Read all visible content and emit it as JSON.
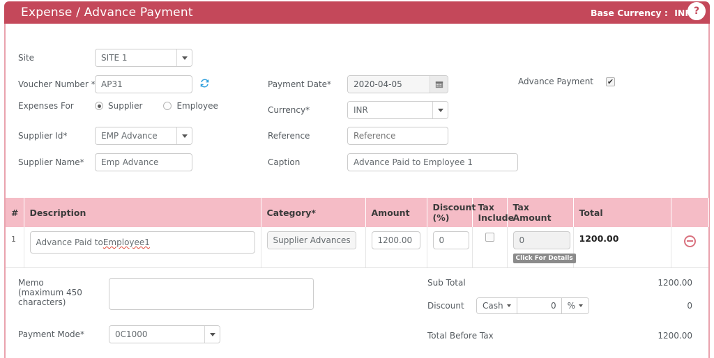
{
  "header": {
    "title": "Expense / Advance Payment",
    "base_currency_label": "Base Currency :",
    "base_currency_value": "INR",
    "help_label": "?",
    "bar_color": "#c4485a"
  },
  "form": {
    "site": {
      "label": "Site",
      "value": "SITE 1"
    },
    "voucher_number": {
      "label": "Voucher Number *",
      "value": "AP31",
      "refresh_icon": "refresh-icon"
    },
    "expenses_for": {
      "label": "Expenses For",
      "options": [
        {
          "label": "Supplier",
          "selected": true
        },
        {
          "label": "Employee",
          "selected": false
        }
      ]
    },
    "supplier_id": {
      "label": "Supplier Id*",
      "value": "EMP Advance"
    },
    "supplier_name": {
      "label": "Supplier Name*",
      "value": "Emp Advance"
    },
    "payment_date": {
      "label": "Payment Date*",
      "value": "2020-04-05",
      "icon": "calendar-icon"
    },
    "currency": {
      "label": "Currency*",
      "value": "INR"
    },
    "reference": {
      "label": "Reference",
      "value": "",
      "placeholder": "Reference"
    },
    "caption": {
      "label": "Caption",
      "value": "Advance Paid to Employee 1"
    },
    "advance_payment": {
      "label": "Advance Payment",
      "checked": true,
      "mark": "✔"
    }
  },
  "items_table": {
    "columns": [
      {
        "key": "num",
        "label": "#"
      },
      {
        "key": "description",
        "label": "Description"
      },
      {
        "key": "category",
        "label": "Category*"
      },
      {
        "key": "amount",
        "label": "Amount"
      },
      {
        "key": "discount",
        "label": "Discount (%)"
      },
      {
        "key": "tax_include",
        "label": "Tax Include"
      },
      {
        "key": "tax_amount",
        "label": "Tax Amount"
      },
      {
        "key": "total",
        "label": "Total"
      },
      {
        "key": "actions",
        "label": ""
      }
    ],
    "header_color": "#f5bcc6",
    "rows": [
      {
        "num": "1",
        "description": "Advance Paid to Employee1",
        "description_misspelled": "Employee1",
        "description_prefix": "Advance Paid to ",
        "category": "Supplier Advances",
        "amount": "1200.00",
        "discount": "0",
        "tax_include_checked": false,
        "tax_amount": "0",
        "tax_amount_tooltip": "Click For Details",
        "total": "1200.00",
        "delete_icon": "remove-circle-icon"
      }
    ]
  },
  "bottom": {
    "memo": {
      "label_line1": "Memo",
      "label_line2": "(maximum 450",
      "label_line3": "characters)",
      "value": ""
    },
    "payment_mode": {
      "label": "Payment Mode*",
      "value": "0C1000"
    },
    "totals": [
      {
        "label": "Sub Total",
        "value": "1200.00"
      },
      {
        "label": "Total Before Tax",
        "value": "1200.00"
      }
    ],
    "discount": {
      "label": "Discount",
      "type_value": "Cash",
      "amount_value": "0",
      "unit_value": "%",
      "result_value": "0"
    }
  }
}
